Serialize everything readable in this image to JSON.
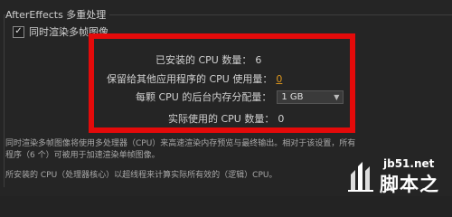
{
  "section": {
    "title": "AfterEffects 多重处理"
  },
  "checkbox": {
    "label": "同时渲染多帧图像",
    "checked": true,
    "check_glyph": "✓"
  },
  "settings": {
    "installed_cpu_label": "已安装的 CPU 数量：",
    "installed_cpu_value": "6",
    "reserved_cpu_label": "保留给其他应用程序的 CPU 使用量：",
    "reserved_cpu_value": "0",
    "memory_label": "每颗 CPU 的后台内存分配量：",
    "memory_value": "1 GB",
    "actual_cpu_label": "实际使用的 CPU 数量：",
    "actual_cpu_value": "0"
  },
  "description": {
    "line1": "同时渲染多帧图像将使用多处理器（CPU）来高速渲染内存预览与最终输出。相对于该设置，所有",
    "line2": "程序（6 个）可被用于加速渲染单帧图像。",
    "line3": "所安装的 CPU（处理器核心）以超线程来计算实际所有效的（逻辑）CPU。"
  },
  "watermark": {
    "url": "jb51.net",
    "name": "脚本之家"
  },
  "colors": {
    "highlight": "#e40a0a",
    "accent_orange": "#d8941e"
  },
  "icons": {
    "dropdown": "chevron-down-icon",
    "logo": "jb51-logo-icon"
  }
}
